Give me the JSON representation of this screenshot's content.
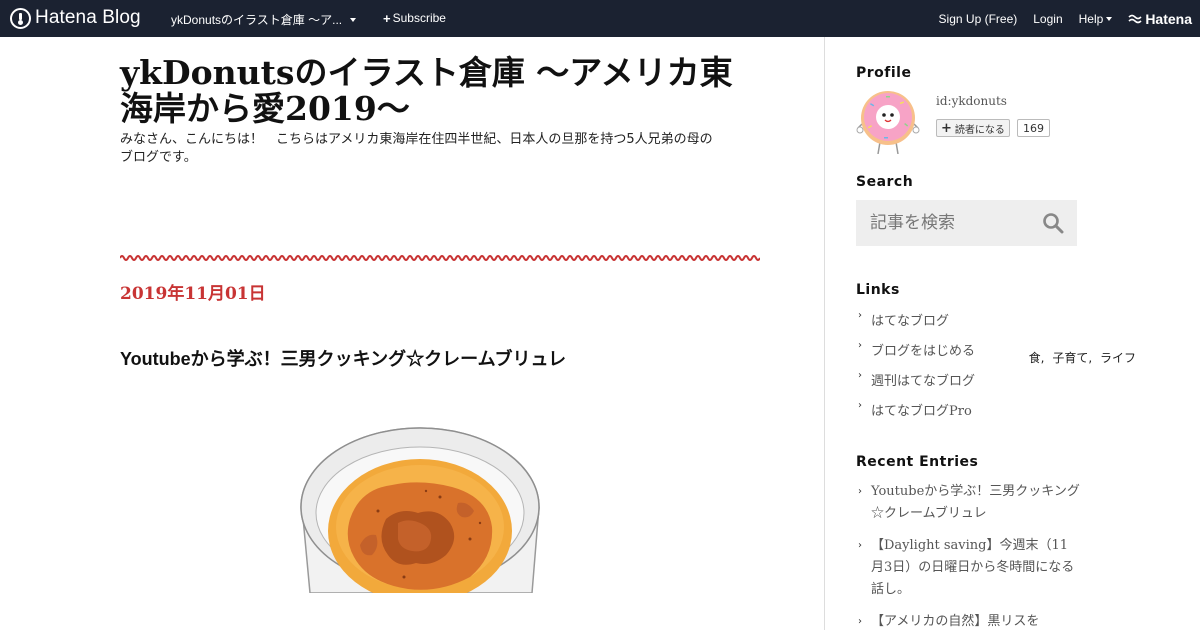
{
  "topbar": {
    "logo_text": "Hatena Blog",
    "blog_switch": "ykDonutsのイラスト倉庫 ～ア...",
    "subscribe": "Subscribe",
    "signup": "Sign Up (Free)",
    "login": "Login",
    "help": "Help",
    "brand": "Hatena"
  },
  "header": {
    "title": "ykDonutsのイラスト倉庫 ～アメリカ東海岸から愛2019～",
    "description": "みなさん、こんにちは！　こちらはアメリカ東海岸在住四半世紀、日本人の旦那を持つ5人兄弟の母のブログです。"
  },
  "entry": {
    "date": "2019年11月01日",
    "title": "Youtubeから学ぶ！三男クッキング☆クレームブリュレ",
    "categories": [
      "食,",
      "子育て,",
      "ライフ"
    ]
  },
  "sidebar": {
    "profile": {
      "heading": "Profile",
      "id": "id:ykdonuts",
      "reader_button": "読者になる",
      "reader_count": "169"
    },
    "search": {
      "heading": "Search",
      "placeholder": "記事を検索"
    },
    "links": {
      "heading": "Links",
      "items": [
        "はてなブログ",
        "ブログをはじめる",
        "週刊はてなブログ",
        "はてなブログPro"
      ]
    },
    "recent": {
      "heading": "Recent Entries",
      "items": [
        "Youtubeから学ぶ！三男クッキング☆クレームブリュレ",
        "【Daylight saving】今週末（11月3日）の日曜日から冬時間になる話し。",
        "【アメリカの自然】黒リスを"
      ]
    }
  },
  "colors": {
    "topbar_bg": "#1b2231",
    "accent_red": "#c83434",
    "sidebar_link": "#555555"
  },
  "icons": {
    "logo": "hatena-blog-logo-icon",
    "search": "search-icon",
    "caret": "chevron-down-icon",
    "plus": "plus-icon"
  }
}
